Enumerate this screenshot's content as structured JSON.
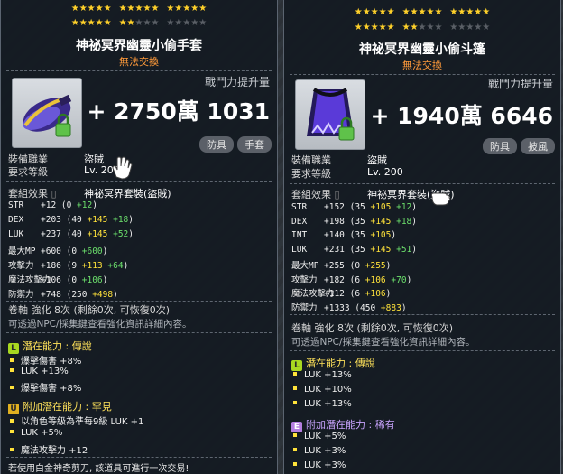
{
  "left": {
    "stars_row1": [
      5,
      5,
      5
    ],
    "stars_row2": {
      "on": 7,
      "total": 15
    },
    "title": "神祕冥界幽靈小偷手套",
    "no_trade": "無法交換",
    "cp_label": "戰鬥力提升量",
    "cp_value": "+ 2750萬 1031",
    "tags": [
      "防具",
      "手套"
    ],
    "job_label": "裝備職業",
    "job_value": "盜賊",
    "level_label": "要求等級",
    "level_value": "Lv. 200",
    "set_label": "套組效果",
    "set_value": "神祕冥界套裝(盜賊)",
    "stats": [
      {
        "name": "STR",
        "text": "+12 (0 ",
        "y": "",
        "g": "+12",
        "end": ")"
      },
      {
        "name": "DEX",
        "text": "+203 (40 ",
        "y": "+145",
        "g": "+18",
        "end": ")"
      },
      {
        "name": "LUK",
        "text": "+237 (40 ",
        "y": "+145",
        "g": "+52",
        "end": ")"
      },
      {
        "name": "最大MP",
        "text": "+600 (0 ",
        "y": "",
        "g": "+600",
        "end": ")"
      },
      {
        "name": "攻擊力",
        "text": "+186 (9 ",
        "y": "+113",
        "g": "+64",
        "end": ")"
      },
      {
        "name": "魔法攻擊力",
        "text": "+106 (0 ",
        "y": "",
        "g": "+106",
        "end": ")"
      },
      {
        "name": "防禦力",
        "text": "+748 (250 ",
        "y": "+498",
        "g": "",
        "end": ")"
      }
    ],
    "scroll": "卷軸 強化 8次 (剩餘0次, 可恢復0次)",
    "enh_note": "可透過NPC/採集鍵查看強化資訊詳細內容。",
    "pot_header": "潛在能力 : 傳說",
    "pot_lines": [
      "爆擊傷害 +8%",
      "LUK +13%",
      "爆擊傷害 +8%"
    ],
    "add_header": "附加潛在能力 : 罕見",
    "add_lines": [
      "以角色等級為準每9級 LUK +1",
      "LUK +5%",
      "魔法攻擊力 +12"
    ],
    "footer": "若使用白金神奇剪刀, 該道具可進行一次交易!"
  },
  "right": {
    "stars_row1": [
      5,
      5,
      5
    ],
    "stars_row2": {
      "on": 7,
      "total": 15
    },
    "title": "神祕冥界幽靈小偷斗篷",
    "no_trade": "無法交換",
    "cp_label": "戰鬥力提升量",
    "cp_value": "+ 1940萬 6646",
    "tags": [
      "防具",
      "披風"
    ],
    "job_label": "裝備職業",
    "job_value": "盜賊",
    "level_label": "要求等級",
    "level_value": "Lv. 200",
    "set_label": "套組效果",
    "set_value": "神祕冥界套裝(盜賊)",
    "stats": [
      {
        "name": "STR",
        "text": "+152 (35 ",
        "y": "+105",
        "g": "+12",
        "end": ")"
      },
      {
        "name": "DEX",
        "text": "+198 (35 ",
        "y": "+145",
        "g": "+18",
        "end": ")"
      },
      {
        "name": "INT",
        "text": "+140 (35 ",
        "y": "+105",
        "g": "",
        "end": ")"
      },
      {
        "name": "LUK",
        "text": "+231 (35 ",
        "y": "+145",
        "g": "+51",
        "end": ")"
      },
      {
        "name": "最大MP",
        "text": "+255 (0 ",
        "y": "+255",
        "g": "",
        "end": ")"
      },
      {
        "name": "攻擊力",
        "text": "+182 (6 ",
        "y": "+106",
        "g": "+70",
        "end": ")"
      },
      {
        "name": "魔法攻擊力",
        "text": "+112 (6 ",
        "y": "+106",
        "g": "",
        "end": ")"
      },
      {
        "name": "防禦力",
        "text": "+1333 (450 ",
        "y": "+883",
        "g": "",
        "end": ")"
      }
    ],
    "scroll": "卷軸 強化 8次 (剩餘0次, 可恢復0次)",
    "enh_note": "可透過NPC/採集鍵查看強化資訊詳細內容。",
    "pot_header": "潛在能力 : 傳說",
    "pot_lines": [
      "LUK +13%",
      "LUK +10%",
      "LUK +13%"
    ],
    "add_header": "附加潛在能力 : 稀有",
    "add_lines": [
      "LUK +5%",
      "LUK +3%",
      "LUK +3%"
    ]
  }
}
